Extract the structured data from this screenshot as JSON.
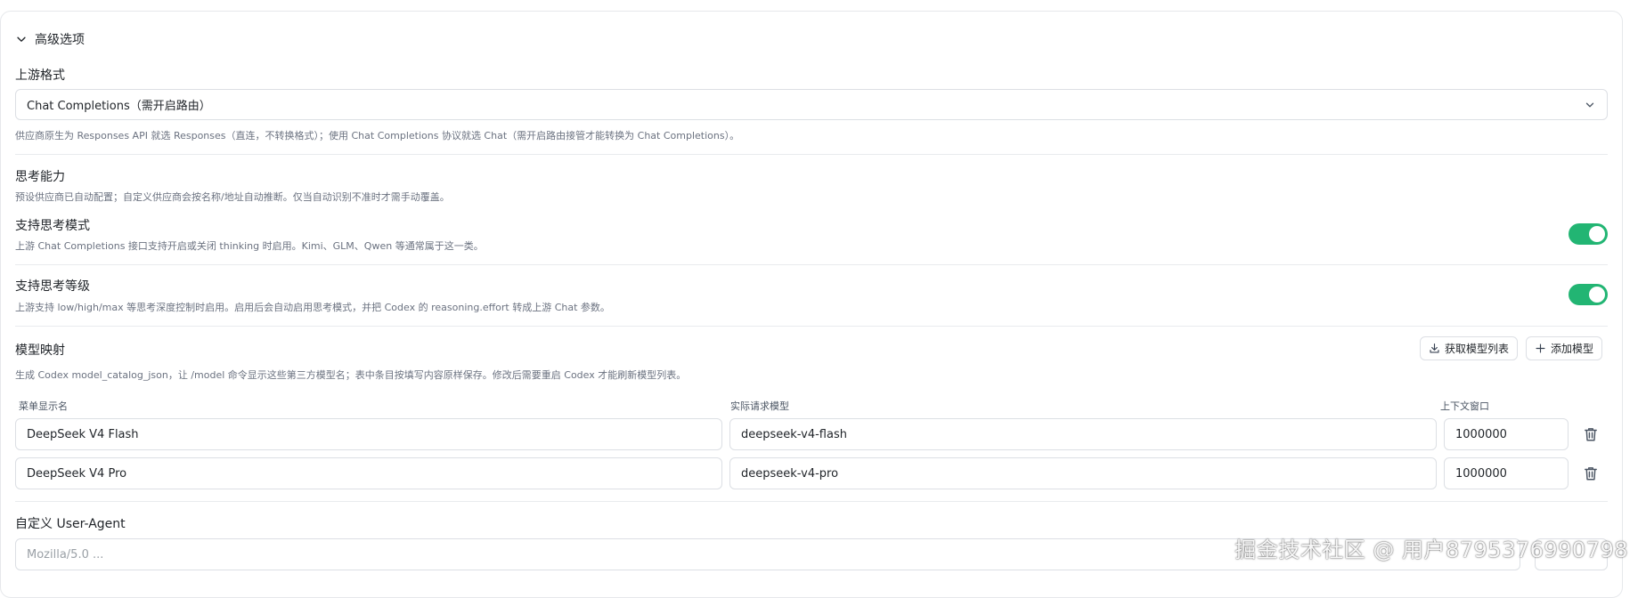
{
  "advanced": {
    "title": "高级选项",
    "upstream_format": {
      "label": "上游格式",
      "selected": "Chat Completions（需开启路由）",
      "hint": "供应商原生为 Responses API 就选 Responses（直连，不转换格式）；使用 Chat Completions 协议就选 Chat（需开启路由接管才能转换为 Chat Completions）。"
    },
    "thinking": {
      "label": "思考能力",
      "hint": "预设供应商已自动配置；自定义供应商会按名称/地址自动推断。仅当自动识别不准时才需手动覆盖。",
      "mode": {
        "label": "支持思考模式",
        "hint": "上游 Chat Completions 接口支持开启或关闭 thinking 时启用。Kimi、GLM、Qwen 等通常属于这一类。",
        "enabled": true
      },
      "level": {
        "label": "支持思考等级",
        "hint": "上游支持 low/high/max 等思考深度控制时启用。启用后会自动启用思考模式，并把 Codex 的 reasoning.effort 转成上游 Chat 参数。",
        "enabled": true
      }
    },
    "model_mapping": {
      "label": "模型映射",
      "hint": "生成 Codex model_catalog_json，让 /model 命令显示这些第三方模型名；表中条目按填写内容原样保存。修改后需要重启 Codex 才能刷新模型列表。",
      "fetch_button": "获取模型列表",
      "add_button": "添加模型",
      "columns": [
        "菜单显示名",
        "实际请求模型",
        "上下文窗口"
      ],
      "rows": [
        {
          "display": "DeepSeek V4 Flash",
          "model": "deepseek-v4-flash",
          "context": "1000000"
        },
        {
          "display": "DeepSeek V4 Pro",
          "model": "deepseek-v4-pro",
          "context": "1000000"
        }
      ]
    },
    "user_agent": {
      "label": "自定义 User-Agent",
      "placeholder": "Mozilla/5.0 ..."
    }
  },
  "watermark": "掘金技术社区 @ 用户8795376990798",
  "colors": {
    "toggle_on": "#22b573",
    "border": "#dcdfe4",
    "hint_text": "#6b7280"
  }
}
